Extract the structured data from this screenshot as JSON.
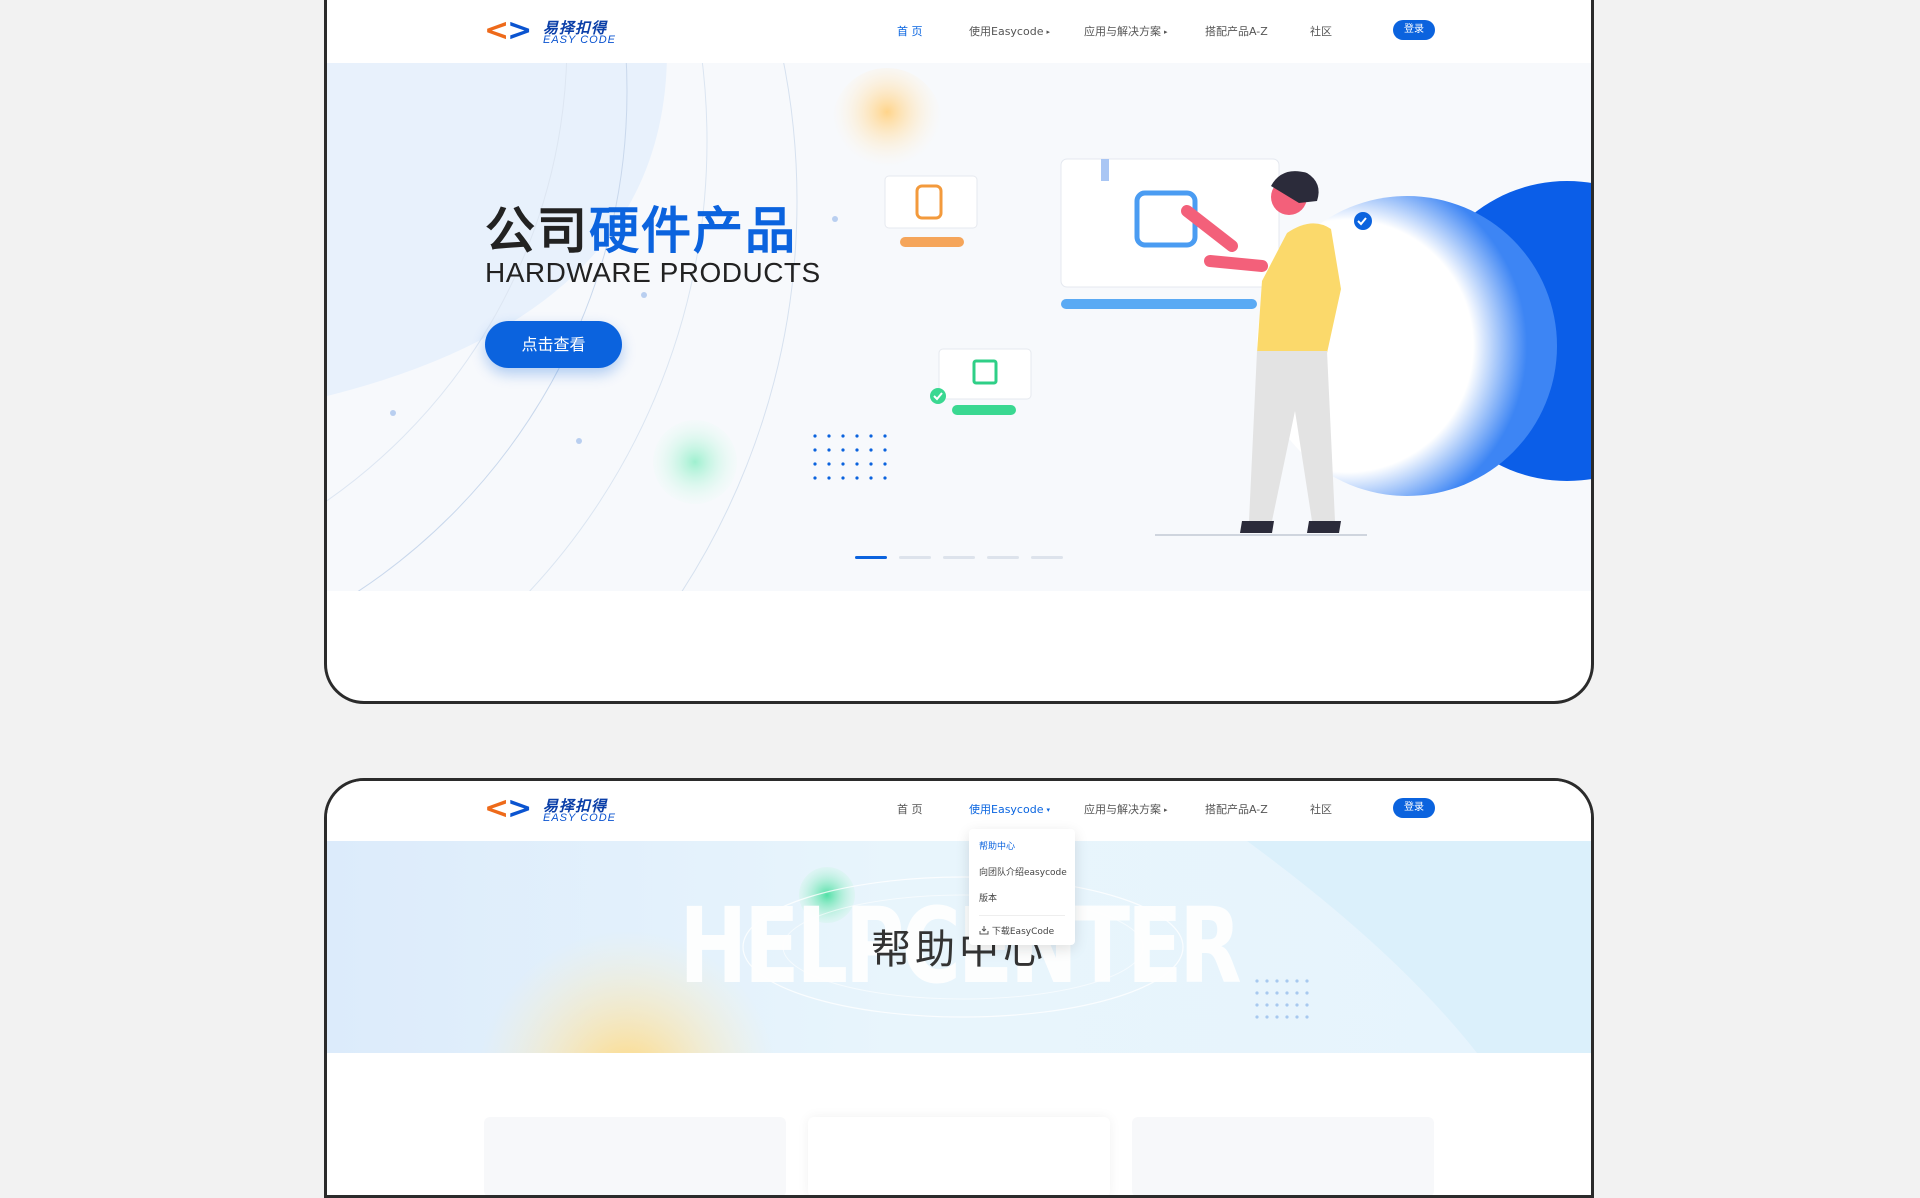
{
  "logo": {
    "brackets_left": "<",
    "brackets_right": ">",
    "cn": "易择扣得",
    "en": "EASY CODE"
  },
  "nav": {
    "items": [
      {
        "label": "首 页",
        "dropdown": false
      },
      {
        "label": "使用Easycode",
        "dropdown": true
      },
      {
        "label": "应用与解决方案",
        "dropdown": true
      },
      {
        "label": "搭配产品A-Z",
        "dropdown": false
      },
      {
        "label": "社区",
        "dropdown": false
      }
    ],
    "caret": "▸",
    "caret_open": "▾",
    "login": "登录"
  },
  "hero1": {
    "title_dark": "公司",
    "title_blue": "硬件产品",
    "subtitle": "HARDWARE PRODUCTS",
    "button": "点击查看",
    "carousel_count": 5,
    "carousel_active": 1
  },
  "hero2": {
    "bg_text": "HELPCENTER",
    "title": "帮助中心"
  },
  "dropdown": {
    "items": [
      {
        "label": "帮助中心",
        "active": true
      },
      {
        "label": "向团队介绍easycode",
        "active": false
      },
      {
        "label": "版本",
        "active": false
      }
    ],
    "download": "下载EasyCode"
  },
  "colors": {
    "primary": "#0b63de",
    "accent_orange": "#ee6a1a",
    "background": "#f2f2f2"
  }
}
